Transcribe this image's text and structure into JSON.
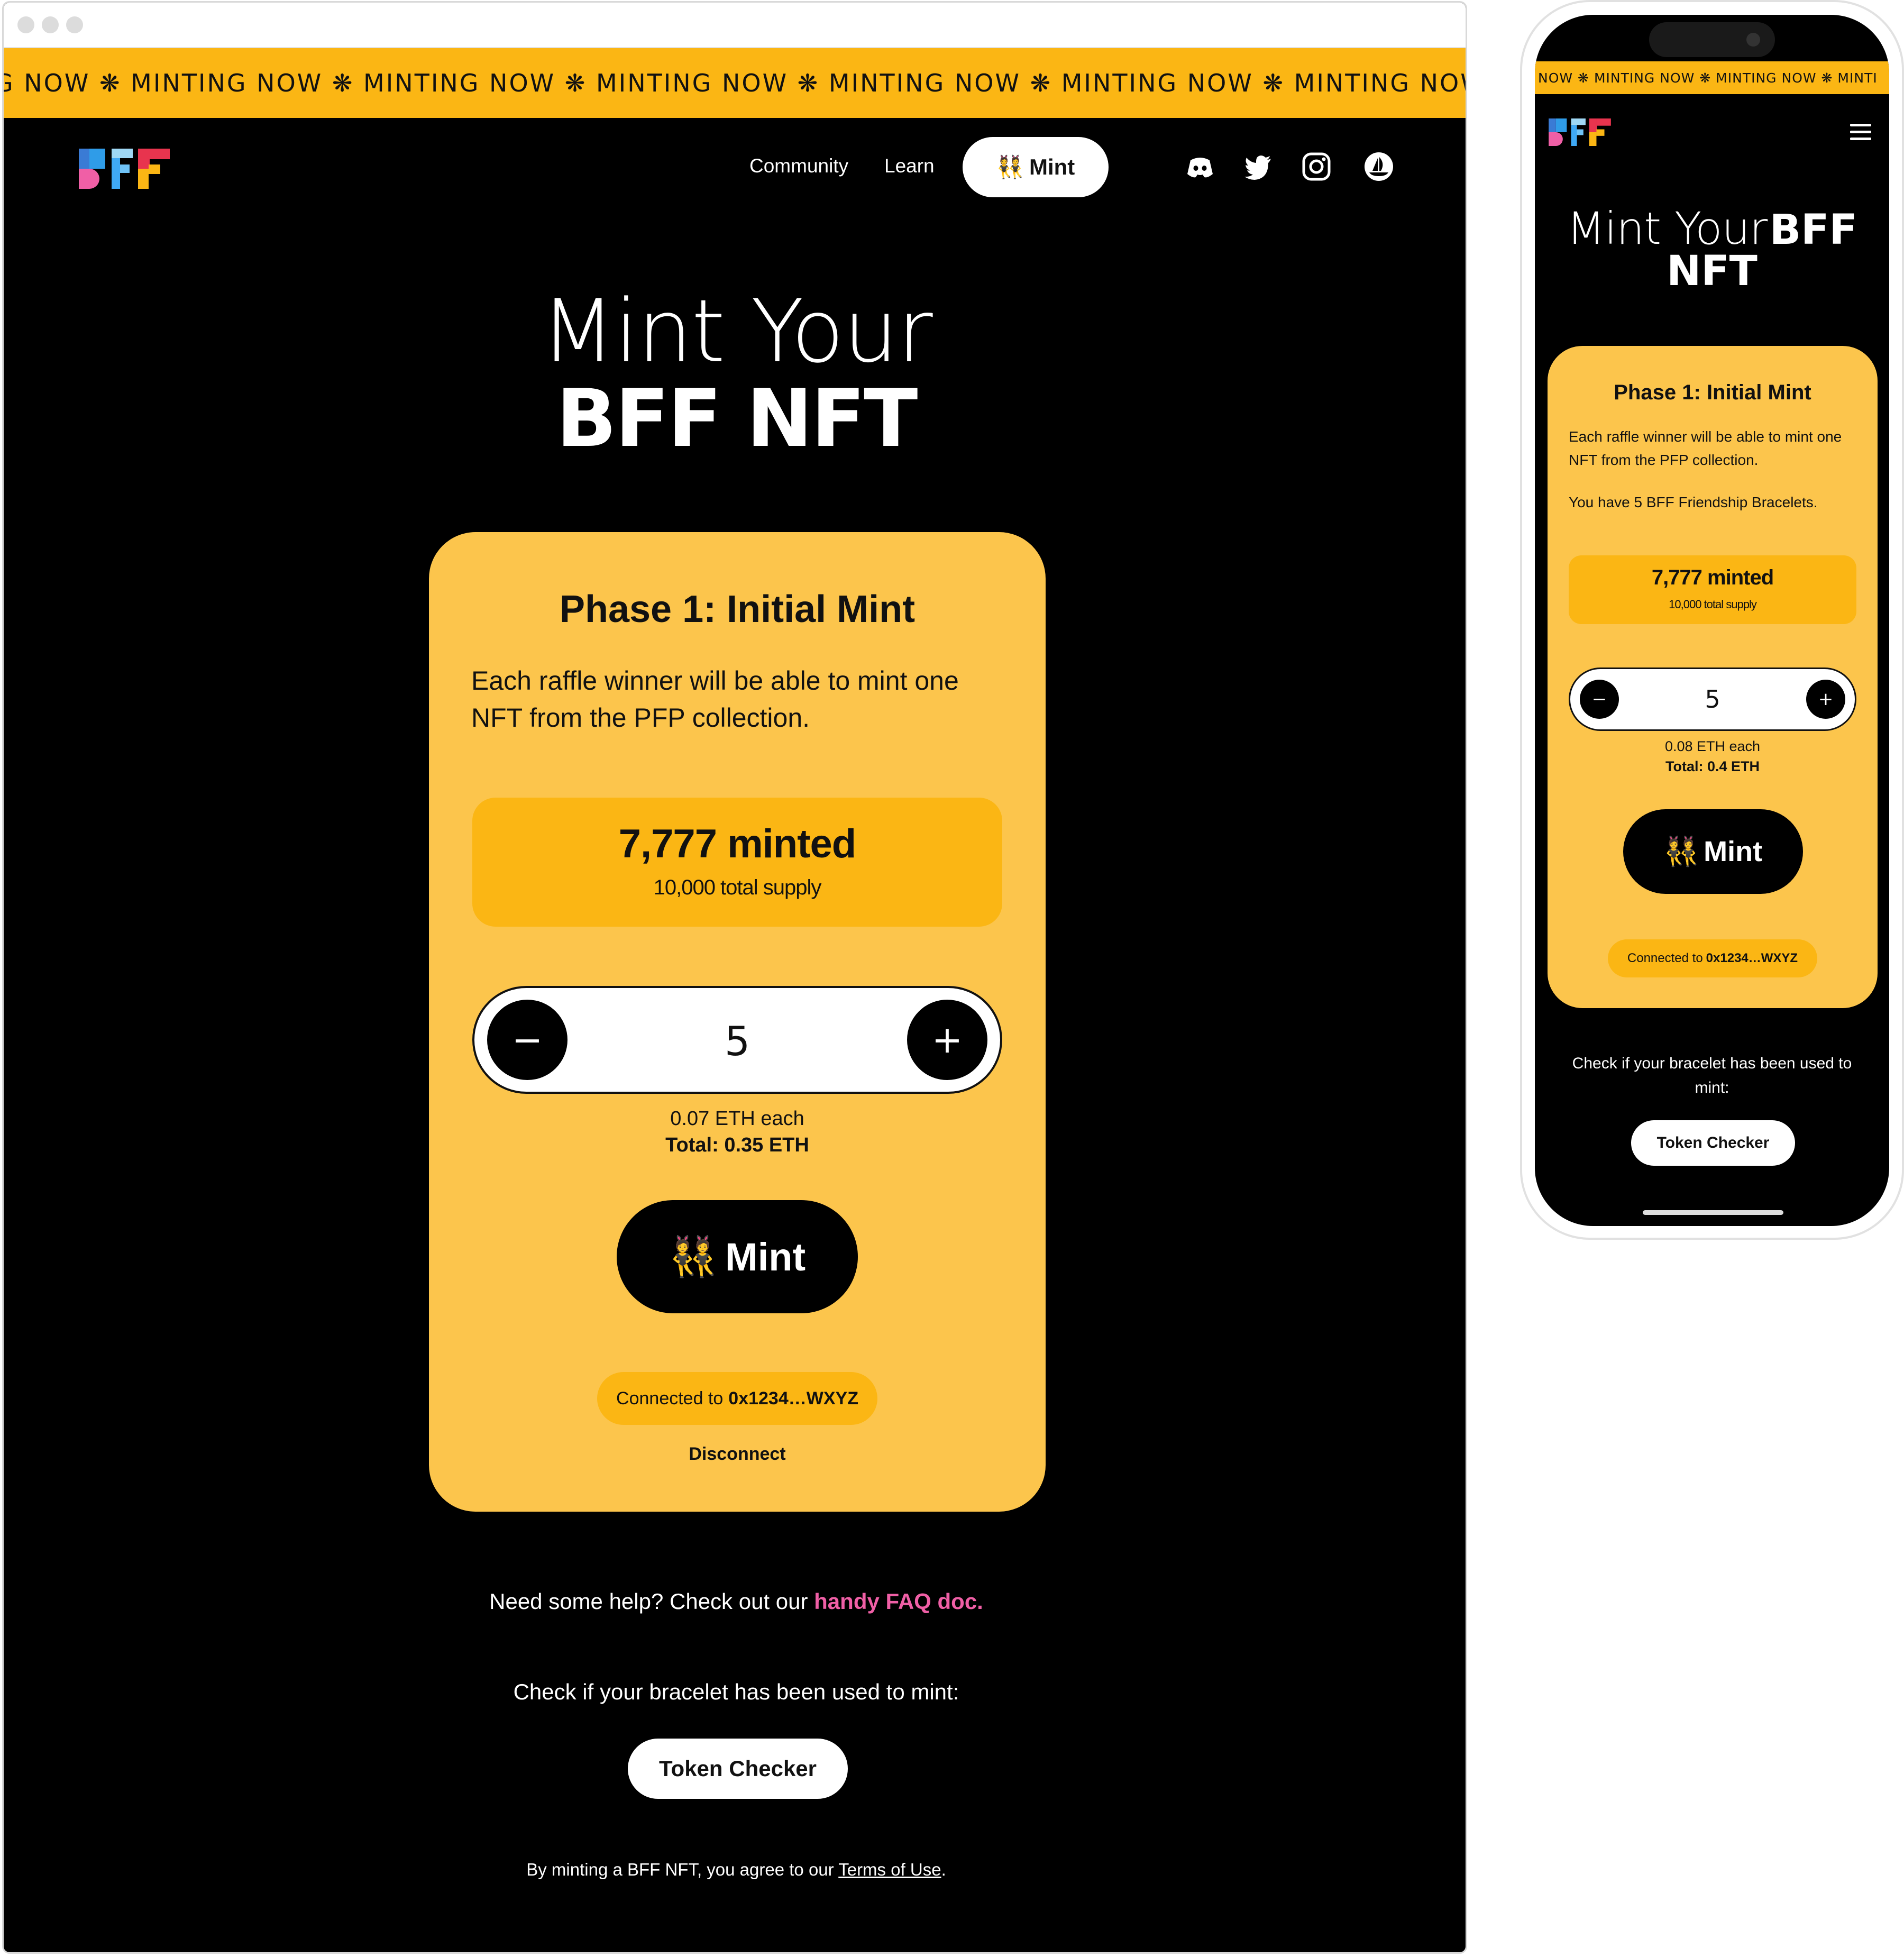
{
  "ticker": {
    "text": "G NOW ❋ MINTING NOW ❋ MINTING NOW ❋ MINTING NOW ❋ MINTING NOW ❋ MINTING NOW ❋ MINTING NOW ❋ MINTING NOW ❋ MI"
  },
  "nav": {
    "community": "Community",
    "learn": "Learn",
    "mint": "Mint",
    "social": [
      "discord-icon",
      "twitter-icon",
      "instagram-icon",
      "opensea-icon"
    ]
  },
  "hero": {
    "line1": "Mint Your",
    "line2": "BFF NFT"
  },
  "card": {
    "title": "Phase 1: Initial Mint",
    "description": "Each raffle winner will be able to mint one NFT from the PFP collection.",
    "minted": "7,777 minted",
    "supply": "10,000 total supply",
    "quantity": "5",
    "minus": "−",
    "plus": "+",
    "price_each": "0.07 ETH each",
    "price_total": "Total: 0.35 ETH",
    "mint_button": "Mint",
    "connected_prefix": "Connected to",
    "wallet": "0x1234…WXYZ",
    "disconnect": "Disconnect"
  },
  "footer": {
    "help_prefix": "Need some help? Check out our",
    "faq_link": "handy FAQ doc.",
    "check": "Check if your bracelet has been used to mint:",
    "token_checker": "Token Checker",
    "terms_prefix": "By minting a BFF NFT, you agree to our",
    "terms_link": "Terms of Use",
    "terms_suffix": "."
  },
  "mobile": {
    "ticker": "NOW ❋ MINTING NOW ❋ MINTING NOW ❋ MINTI",
    "hero_light": "Mint Your",
    "hero_bold_1": "BFF",
    "hero_bold_2": "NFT",
    "card_title": "Phase 1: Initial Mint",
    "card_desc": "Each raffle winner will be able to mint one NFT from the PFP collection.",
    "bracelets": "You have 5 BFF Friendship Bracelets.",
    "minted": "7,777 minted",
    "supply": "10,000 total supply",
    "quantity": "5",
    "minus": "−",
    "plus": "+",
    "price_each": "0.08 ETH each",
    "price_total": "Total: 0.4 ETH",
    "mint_button": "Mint",
    "connected_prefix": "Connected to",
    "wallet": "0x1234…WXYZ",
    "check": "Check if your bracelet has been used to mint:",
    "token_checker": "Token Checker"
  },
  "colors": {
    "ticker": "#fbb614",
    "card": "#fcc54c",
    "accent_pink": "#f05fa6",
    "background": "#000000"
  }
}
